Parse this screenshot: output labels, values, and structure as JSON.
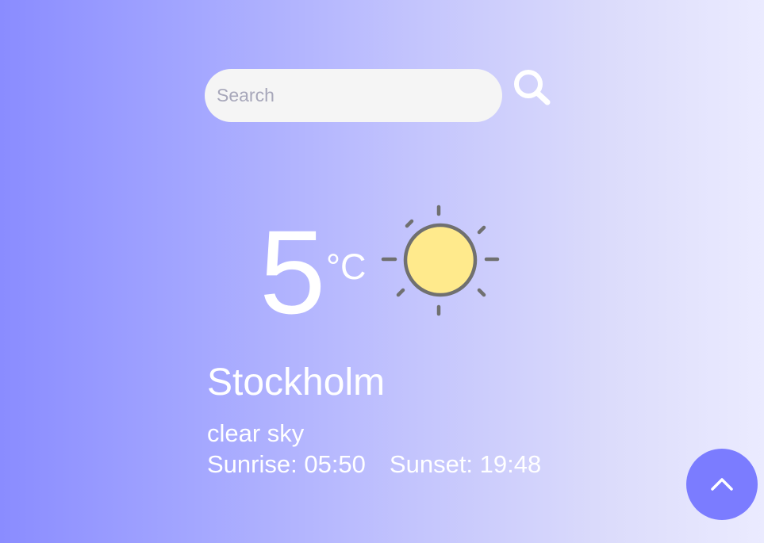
{
  "search": {
    "placeholder": "Search",
    "value": "",
    "button_icon": "search-icon"
  },
  "weather": {
    "temperature": "5",
    "unit": "°C",
    "icon": "sun-icon",
    "city": "Stockholm",
    "description": "clear sky",
    "sunrise": "Sunrise: 05:50",
    "sunset": "Sunset: 19:48"
  },
  "scroll_top": {
    "icon": "chevron-up-icon"
  },
  "colors": {
    "accent": "#7b7cff",
    "sun_fill": "#ffea8c",
    "sun_stroke": "#707070",
    "gradient_start": "#8a8cff",
    "gradient_end": "#ebebff"
  }
}
